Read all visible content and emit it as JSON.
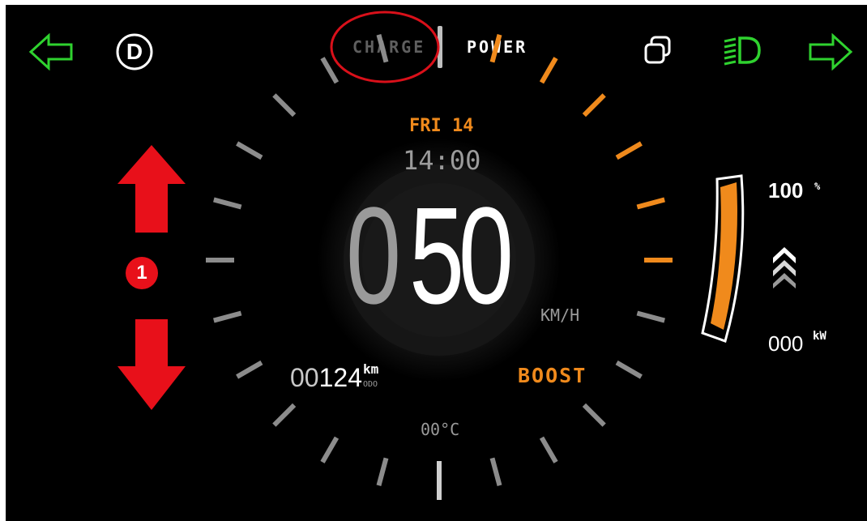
{
  "header": {
    "charge_label": "CHARGE",
    "power_label": "POWER",
    "drive_mode": "D"
  },
  "center": {
    "date": "FRI 14",
    "time": "14:00",
    "speed_leading": "0",
    "speed_value": "50",
    "speed_unit": "KM/H",
    "temperature": "00°C"
  },
  "odometer": {
    "leading": "00",
    "value": "124",
    "unit": "km",
    "label": "ODO"
  },
  "mode": {
    "label": "BOOST"
  },
  "battery": {
    "level_percent": 100,
    "value": "100",
    "unit": "%"
  },
  "power_output": {
    "value": "000",
    "unit": "kW"
  },
  "gear": {
    "number": "1"
  },
  "colors": {
    "background": "#000000",
    "accent_orange": "#f08a1c",
    "indicator_green": "#2fd22f",
    "gear_red": "#e8101a",
    "annotation_red": "#d9101a",
    "tick_gray": "#8c8c8c"
  },
  "icons": {
    "left_indicator": "arrow-left-outline-icon",
    "right_indicator": "arrow-right-outline-icon",
    "headlight": "high-beam-icon",
    "copy": "copy-windows-icon",
    "gear_up": "arrow-up-icon",
    "gear_down": "arrow-down-icon",
    "regen": "chevrons-up-icon"
  }
}
